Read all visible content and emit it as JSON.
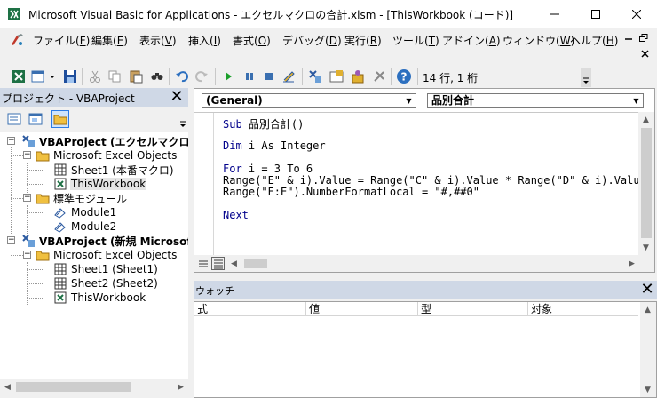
{
  "window": {
    "title": "Microsoft Visual Basic for Applications - エクセルマクロの合計.xlsm - [ThisWorkbook (コード)]"
  },
  "menu": {
    "items": [
      {
        "label": "ファイル(",
        "key": "F",
        "tail": ")"
      },
      {
        "label": "編集(",
        "key": "E",
        "tail": ")"
      },
      {
        "label": "表示(",
        "key": "V",
        "tail": ")"
      },
      {
        "label": "挿入(",
        "key": "I",
        "tail": ")"
      },
      {
        "label": "書式(",
        "key": "O",
        "tail": ")"
      },
      {
        "label": "デバッグ(",
        "key": "D",
        "tail": ")"
      },
      {
        "label": "実行(",
        "key": "R",
        "tail": ")"
      },
      {
        "label": "ツール(",
        "key": "T",
        "tail": ")"
      },
      {
        "label": "アドイン(",
        "key": "A",
        "tail": ")"
      },
      {
        "label": "ウィンドウ(",
        "key": "W",
        "tail": ")"
      },
      {
        "label": "ヘルプ(",
        "key": "H",
        "tail": ")"
      }
    ]
  },
  "toolbar": {
    "position_text": "14 行, 1 桁"
  },
  "project": {
    "title": "プロジェクト - VBAProject",
    "nodes": {
      "p1": "VBAProject (エクセルマクロの合",
      "p1_objects": "Microsoft Excel Objects",
      "p1_sheet1": "Sheet1 (本番マクロ)",
      "p1_thisworkbook": "ThisWorkbook",
      "p1_modules": "標準モジュール",
      "p1_module1": "Module1",
      "p1_module2": "Module2",
      "p2": "VBAProject (新規 Microsoft",
      "p2_objects": "Microsoft Excel Objects",
      "p2_sheet1": "Sheet1 (Sheet1)",
      "p2_sheet2": "Sheet2 (Sheet2)",
      "p2_thisworkbook": "ThisWorkbook"
    }
  },
  "code": {
    "object_combo": "(General)",
    "procedure_combo": "品別合計",
    "lines": [
      {
        "kw": "Sub",
        "rest": " 品別合計()"
      },
      {
        "kw": "",
        "rest": ""
      },
      {
        "kw": "Dim",
        "rest": " i As Integer"
      },
      {
        "kw": "",
        "rest": ""
      },
      {
        "kw": "For",
        "rest": " i = 3 To 6"
      },
      {
        "kw": "",
        "rest": "Range(\"E\" & i).Value = Range(\"C\" & i).Value * Range(\"D\" & i).Value"
      },
      {
        "kw": "",
        "rest": "Range(\"E:E\").NumberFormatLocal = \"#,##0\""
      },
      {
        "kw": "",
        "rest": ""
      },
      {
        "kw": "Next",
        "rest": ""
      }
    ]
  },
  "watch": {
    "title": "ウォッチ",
    "columns": [
      "式",
      "値",
      "型",
      "対象"
    ]
  },
  "colors": {
    "keyword": "#00008b",
    "pane_title_bg": "#cfd8e6"
  }
}
